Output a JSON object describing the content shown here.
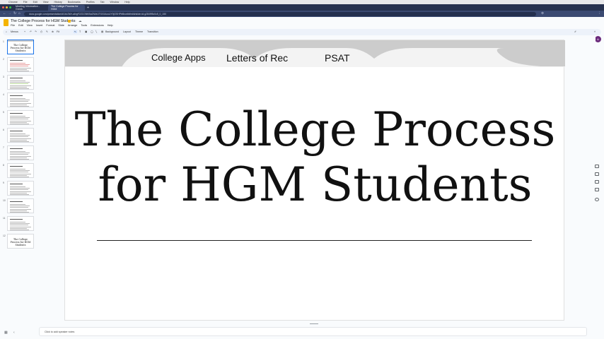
{
  "os_menubar": {
    "items": [
      "Chrome",
      "File",
      "Edit",
      "View",
      "History",
      "Bookmarks",
      "Profiles",
      "Tab",
      "Window",
      "Help"
    ]
  },
  "browser": {
    "tabs": [
      {
        "label": "Meeting Information - Greek"
      },
      {
        "label": "The College Process for HGM"
      }
    ],
    "url": "docs.google.com/presentation/d/1bL0Wr-a6rgF2ZCGNKBaOWzIJTIOOAxoUY0jOSHPtrBnwtbf/edit#slide=id.g2849f5c0c5_0_150"
  },
  "doc": {
    "title": "The College Process for HGM Students",
    "menus": [
      "File",
      "Edit",
      "View",
      "Insert",
      "Format",
      "Slide",
      "Arrange",
      "Tools",
      "Extensions",
      "Help"
    ]
  },
  "toolbar": {
    "menus_label": "Menus",
    "zoom": "Fit",
    "background": "Background",
    "layout": "Layout",
    "theme": "Theme",
    "transition": "Transition"
  },
  "header_buttons": {
    "slideshow": "Slideshow",
    "share": "Share",
    "user_initial": "A"
  },
  "filmstrip": {
    "slides": [
      {
        "num": "1",
        "title": "The College Process for HGM Students"
      },
      {
        "num": "2",
        "title": ""
      },
      {
        "num": "3",
        "title": ""
      },
      {
        "num": "4",
        "title": ""
      },
      {
        "num": "5",
        "title": ""
      },
      {
        "num": "6",
        "title": ""
      },
      {
        "num": "7",
        "title": ""
      },
      {
        "num": "8",
        "title": ""
      },
      {
        "num": "9",
        "title": ""
      },
      {
        "num": "10",
        "title": ""
      },
      {
        "num": "11",
        "title": ""
      },
      {
        "num": "12",
        "title": "The College Process for HGM Students"
      }
    ]
  },
  "slide": {
    "tabs": [
      "College Apps",
      "Letters of Rec",
      "PSAT"
    ],
    "title_line1": "The College Process",
    "title_line2": "for HGM Students"
  },
  "notes": {
    "placeholder": "Click to add speaker notes"
  },
  "colors": {
    "accent": "#1a73e8",
    "banner": "#cccccc",
    "docs_yellow": "#f4b400",
    "share_bg": "#c2e7ff"
  }
}
